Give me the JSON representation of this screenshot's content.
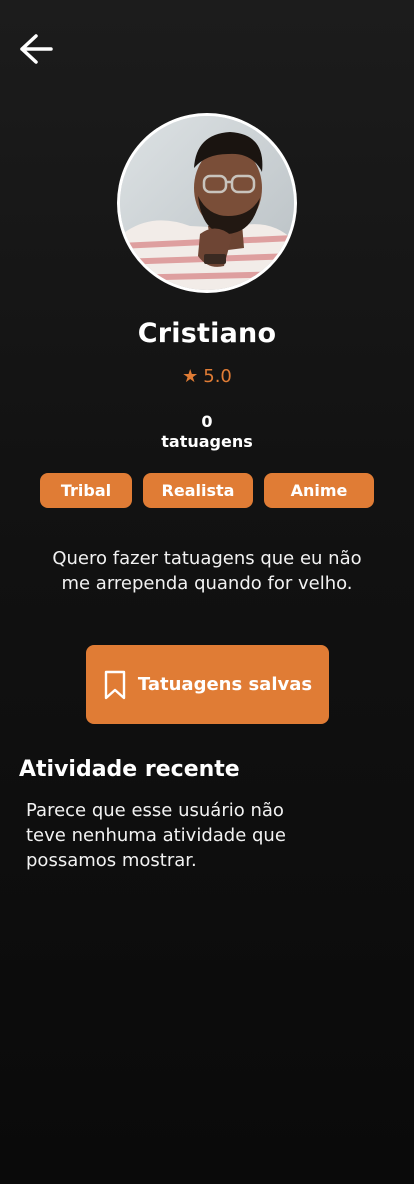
{
  "profile": {
    "name": "Cristiano",
    "rating": "5.0",
    "star_glyph": "★",
    "tattoo_count": "0",
    "tattoo_count_label": "tatuagens",
    "tags": [
      "Tribal",
      "Realista",
      "Anime"
    ],
    "bio": "Quero fazer tatuagens que eu não me arrependa quando for velho."
  },
  "actions": {
    "saved_label": "Tatuagens salvas",
    "saved_icon": "bookmark-icon",
    "back_icon": "arrow-left-icon"
  },
  "activity": {
    "title": "Atividade recente",
    "empty_message": "Parece que esse usuário não teve nenhuma atividade que possamos mostrar."
  },
  "colors": {
    "accent": "#e07c35",
    "background": "#111111",
    "text": "#ffffff"
  }
}
